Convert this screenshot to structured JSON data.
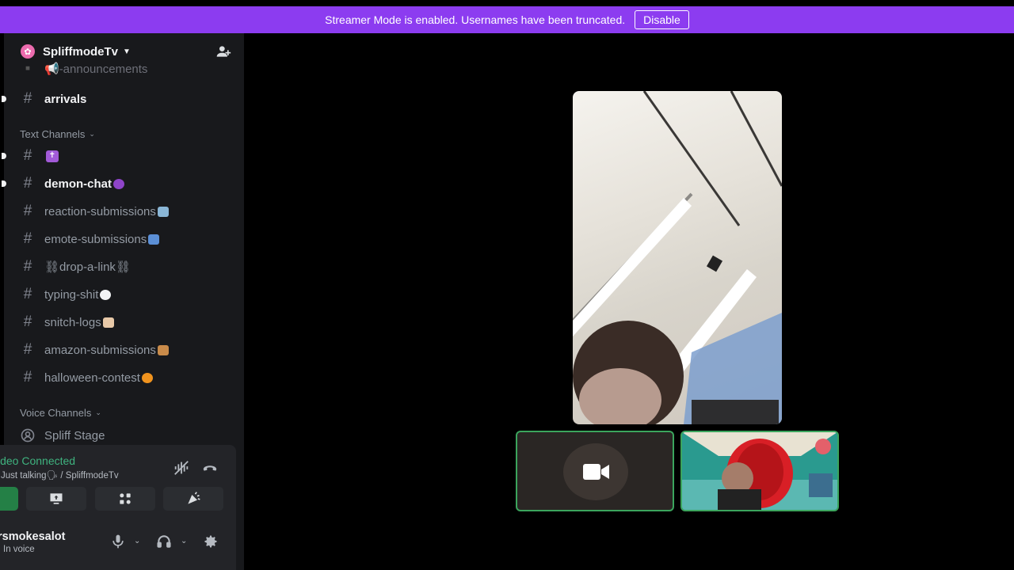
{
  "banner": {
    "message": "Streamer Mode is enabled. Usernames have been truncated.",
    "disable_label": "Disable"
  },
  "server": {
    "name": "SpliffmodeTv"
  },
  "channels_top": [
    {
      "name": "-announcements",
      "emoji_prefix": "megaphone"
    },
    {
      "name": "arrivals",
      "unread": true
    }
  ],
  "categories": {
    "text": "Text Channels",
    "voice": "Voice Channels"
  },
  "text_channels": [
    {
      "name": "",
      "emoji": "cross",
      "unread": true
    },
    {
      "name": "demon-chat",
      "emoji": "imp",
      "unread": true
    },
    {
      "name": "reaction-submissions",
      "emoji": "box"
    },
    {
      "name": "emote-submissions",
      "emoji": "inbox"
    },
    {
      "name": "⛓drop-a-link⛓",
      "emoji": ""
    },
    {
      "name": "typing-shit",
      "emoji": "speech-bubble"
    },
    {
      "name": "snitch-logs",
      "emoji": "folder"
    },
    {
      "name": "amazon-submissions",
      "emoji": "package"
    },
    {
      "name": "halloween-contest",
      "emoji": "pumpkin"
    }
  ],
  "voice_channels": [
    {
      "name": "Spliff Stage"
    }
  ],
  "voice_status": {
    "title": "ideo Connected",
    "subtitle": "Just talking🗣 / SpliffmodeTv"
  },
  "user": {
    "name": "rsmokesalot",
    "status": "In voice"
  },
  "colors": {
    "banner": "#8c3cf0",
    "connected": "#3fb37f",
    "speaking_border": "#3ba55d",
    "sidebar": "#18191c"
  }
}
